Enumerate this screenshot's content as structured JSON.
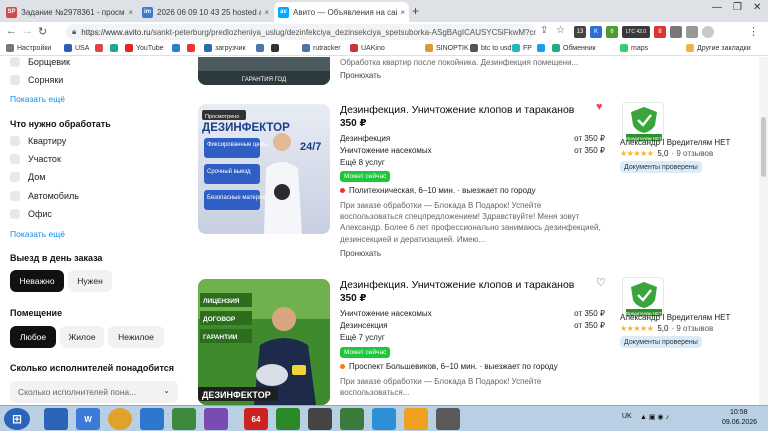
{
  "browser": {
    "tabs": [
      {
        "label": "Задание №2978361 - просмотр з",
        "favicon": "SP",
        "color": "#d04a4a"
      },
      {
        "label": "2026 06 09 10 43 25 hosted at Im",
        "favicon": "im",
        "color": "#3a7bd5"
      },
      {
        "label": "Авито — Объявления на сайте А",
        "favicon": "av",
        "color": "#00aaff"
      }
    ],
    "close_glyph": "×",
    "new_tab": "+",
    "url_host": "https://www.avito.ru",
    "url_path": "/sankt-peterburg/predlozheniya_uslug/dezinfekciya_dezinsekciya_spetsuborka-ASgBAgICAUSYC5iFkwM?contex...",
    "window_controls": [
      "—",
      "❐",
      "✕"
    ],
    "extensions": [
      {
        "label": "13",
        "color": "#444"
      },
      {
        "label": "K",
        "color": "#2a6fd6"
      },
      {
        "label": "6",
        "color": "#4a9d2f"
      },
      {
        "label": "LTC 42.0",
        "color": "#3a3a3a"
      },
      {
        "label": "8",
        "color": "#d33"
      }
    ]
  },
  "bookmarks": [
    {
      "label": "Настройки",
      "color": "#777"
    },
    {
      "label": "USA",
      "color": "#2b5fb3"
    },
    {
      "label": "",
      "color": "#d44"
    },
    {
      "label": "",
      "color": "#2a8"
    },
    {
      "label": "YouTube",
      "color": "#e22"
    },
    {
      "label": "",
      "color": "#2a7fd4"
    },
    {
      "label": "",
      "color": "#e33"
    },
    {
      "label": "загрузчик",
      "color": "#2b6cb0"
    },
    {
      "label": "",
      "color": "#4a76a8"
    },
    {
      "label": "",
      "color": "#333"
    },
    {
      "label": "rutracker",
      "color": "#4a76a8"
    },
    {
      "label": "UAKino",
      "color": "#c33"
    },
    {
      "label": "SINOPTIK",
      "color": "#d93"
    },
    {
      "label": "btc to usd",
      "color": "#555"
    },
    {
      "label": "FP",
      "color": "#2bb"
    },
    {
      "label": "",
      "color": "#1d9bf0"
    },
    {
      "label": "Обменник",
      "color": "#2a8"
    },
    {
      "label": "maps",
      "color": "#3c7"
    },
    {
      "label": "Другие закладки",
      "color": "#e8b64a"
    }
  ],
  "filters": {
    "top_items": [
      "Борщевик",
      "Сорняки"
    ],
    "show_more": "Показать ещё",
    "what_title": "Что нужно обработать",
    "what_items": [
      "Квартиру",
      "Участок",
      "Дом",
      "Автомобиль",
      "Офис"
    ],
    "same_day_title": "Выезд в день заказа",
    "same_day_options": [
      "Неважно",
      "Нужен"
    ],
    "room_title": "Помещение",
    "room_options": [
      "Любое",
      "Жилое",
      "Нежилое"
    ],
    "count_title": "Сколько исполнителей понадобится",
    "count_placeholder": "Сколько исполнителей пона...",
    "chevron": "⌄"
  },
  "prev_listing": {
    "desc": "Обработка квартир после покойника. Дезинфекция помещени...",
    "resend": "Пронюхать",
    "photo_text": "ГАРАНТИЯ ГОД"
  },
  "listings": [
    {
      "title": "Дезинфекция. Уничтожение клопов и тараканов",
      "price": "350 ₽",
      "heart": "♥",
      "heart_color": "#ff4053",
      "prices": [
        {
          "name": "Дезинфекция",
          "value": "от 350 ₽"
        },
        {
          "name": "Уничтожение насекомых",
          "value": "от 350 ₽"
        }
      ],
      "more": "Ещё 8 услуг",
      "badge": "Может сейчас",
      "geo": "Политехническая, 6–10 мин. · выезжает по городу",
      "geo_color": "#e8333a",
      "desc": "При заказе обработки — Блокада В Подарок! Успейте воспользоваться спецпредложением! Здравствуйте! Меня зовут Александр. Более 6 лет профессионально занимаюсь дезинфекцией, дезинсекцией и дератизацией. Имею...",
      "resend": "Пронюхать",
      "photo": {
        "tag": "Просмотрено",
        "brand": "ДЕЗИНФЕКТОР",
        "hours": "24/7",
        "lines": [
          "Фиксированные цены",
          "Срочный выезд",
          "Безопасные материалы"
        ]
      },
      "seller": {
        "logo_text": "Вредителям НЕТ",
        "name": "Александр I Вредителям НЕТ",
        "stars": "★★★★★",
        "rating": "5,0",
        "reviews": "· 9 отзывов",
        "docs": "Документы проверены"
      }
    },
    {
      "title": "Дезинфекция. Уничтожение клопов и тараканов",
      "price": "350 ₽",
      "heart": "♡",
      "heart_color": "#333",
      "prices": [
        {
          "name": "Уничтожение насекомых",
          "value": "от 350 ₽"
        },
        {
          "name": "Дезинсекция",
          "value": "от 350 ₽"
        }
      ],
      "more": "Ещё 7 услуг",
      "badge": "Может сейчас",
      "geo": "Проспект Большевиков, 6–10 мин. · выезжает по городу",
      "geo_color": "#f07a1a",
      "desc": "При заказе обработки — Блокада В Подарок! Успейте воспользоваться...",
      "photo": {
        "lines": [
          "ЛИЦЕНЗИЯ",
          "ДОГОВОР",
          "ГАРАНТИИ"
        ],
        "brand": "ДЕЗИНФЕКТОР"
      },
      "seller": {
        "logo_text": "Вредителям НЕТ",
        "name": "Александр I Вредителям НЕТ",
        "stars": "★★★★★",
        "rating": "5,0",
        "reviews": "· 9 отзывов",
        "docs": "Документы проверены"
      }
    }
  ],
  "taskbar": {
    "start": "⊞",
    "apps": [
      {
        "label": "",
        "color": "#2a63b8"
      },
      {
        "label": "W",
        "color": "#3b7ad9"
      },
      {
        "label": "",
        "color": "#e0a22a"
      },
      {
        "label": "",
        "color": "#2e77d0"
      },
      {
        "label": "",
        "color": "#3d8a3d"
      },
      {
        "label": "",
        "color": "#7a4bb0"
      },
      {
        "label": "64",
        "color": "#c22"
      },
      {
        "label": "",
        "color": "#2a8a2a"
      },
      {
        "label": "",
        "color": "#444"
      },
      {
        "label": "",
        "color": "#3a7a3a"
      },
      {
        "label": "",
        "color": "#2d8fd6"
      },
      {
        "label": "",
        "color": "#f0a020"
      },
      {
        "label": "",
        "color": "#5a5a5a"
      }
    ],
    "lang": "UK",
    "time": "10:58",
    "date": "09.06.2026"
  }
}
